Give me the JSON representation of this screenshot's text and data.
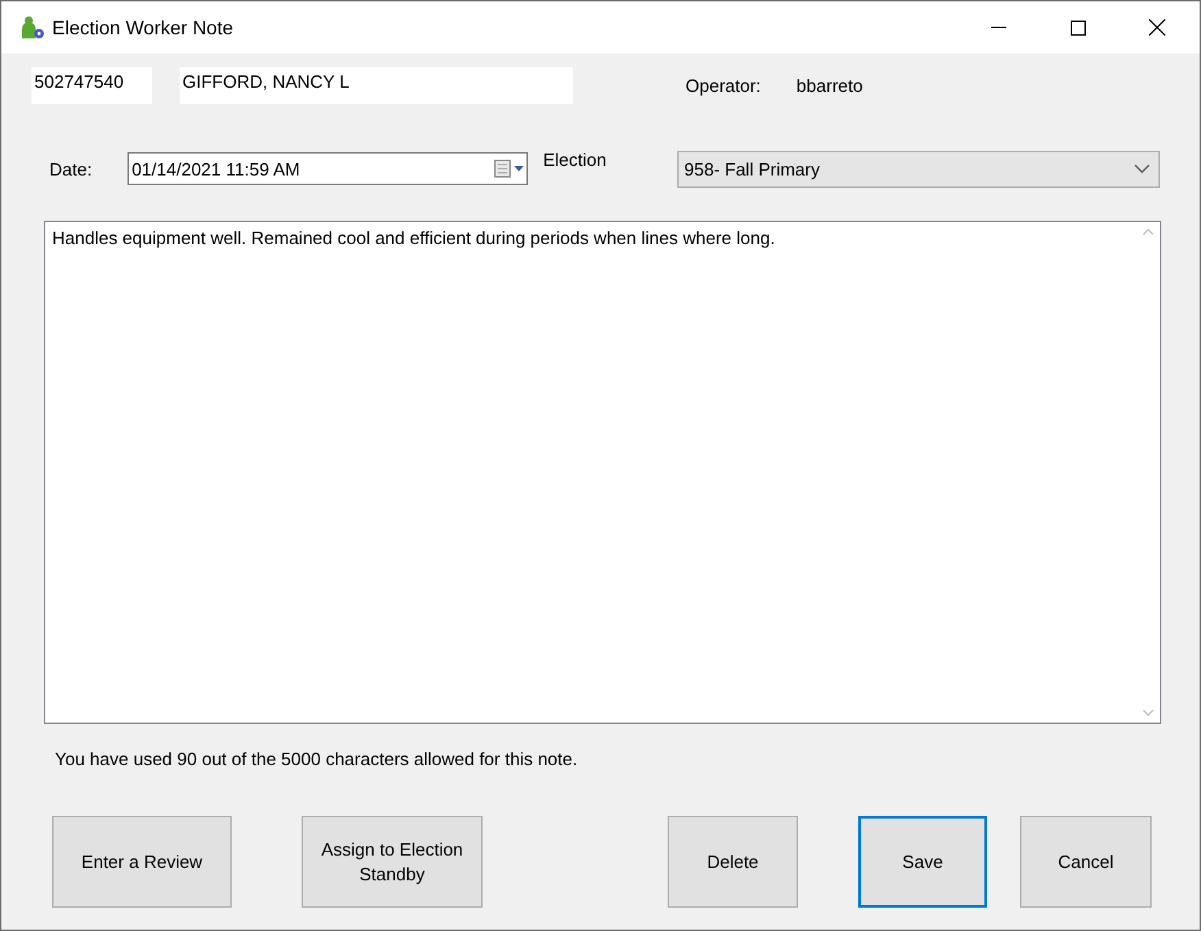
{
  "window": {
    "title": "Election Worker Note"
  },
  "worker": {
    "id": "502747540",
    "name": "GIFFORD, NANCY L"
  },
  "operator": {
    "label": "Operator:",
    "value": "bbarreto"
  },
  "date": {
    "label": "Date:",
    "value": "01/14/2021 11:59 AM"
  },
  "election": {
    "label": "Election",
    "value": "958- Fall Primary"
  },
  "note": {
    "value": "Handles equipment well. Remained cool and efficient during periods when lines where long."
  },
  "char_count": "You have used 90 out of the 5000 characters allowed for this note.",
  "buttons": [
    {
      "label": "Enter a Review",
      "focused": false
    },
    {
      "label": "Assign to Election Standby",
      "focused": false
    },
    {
      "label": "Delete",
      "focused": false
    },
    {
      "label": "Save",
      "focused": true
    },
    {
      "label": "Cancel",
      "focused": false
    }
  ]
}
